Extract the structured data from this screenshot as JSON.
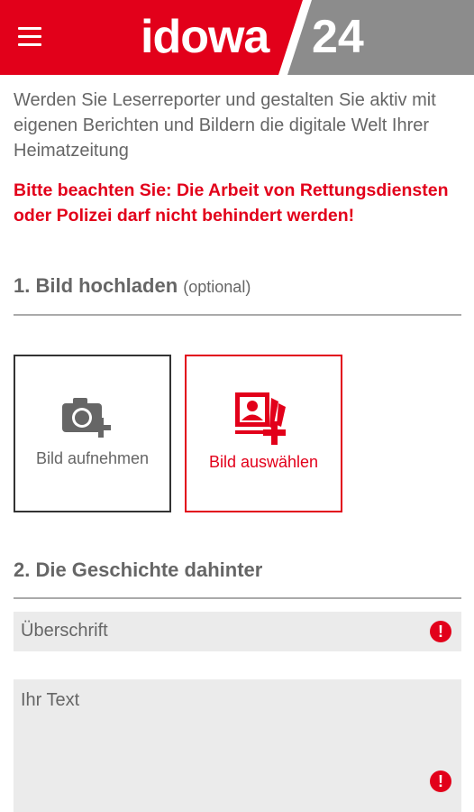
{
  "header": {
    "brand": "idowa",
    "brand_number": "24",
    "menu_icon": "hamburger-menu-icon",
    "colors": {
      "red": "#e2001a",
      "grey": "#8c8c8c"
    }
  },
  "intro_text": "Werden Sie Leserreporter und gestalten Sie aktiv mit eigenen Berichten und Bildern die digitale Welt Ihrer Heimatzeitung",
  "warning_text": "Bitte beachten Sie: Die Arbeit von Rettungsdiensten oder Polizei darf nicht behindert werden!",
  "section1": {
    "title": "1. Bild hochladen",
    "optional": "(optional)"
  },
  "upload": {
    "take_label": "Bild aufnehmen",
    "take_icon": "camera-plus-icon",
    "pick_label": "Bild auswählen",
    "pick_icon": "photo-gallery-plus-icon"
  },
  "section2": {
    "title": "2. Die Geschichte dahinter"
  },
  "form": {
    "headline_placeholder": "Überschrift",
    "text_placeholder": "Ihr Text",
    "required_icon": "alert-icon",
    "required_glyph": "!"
  }
}
